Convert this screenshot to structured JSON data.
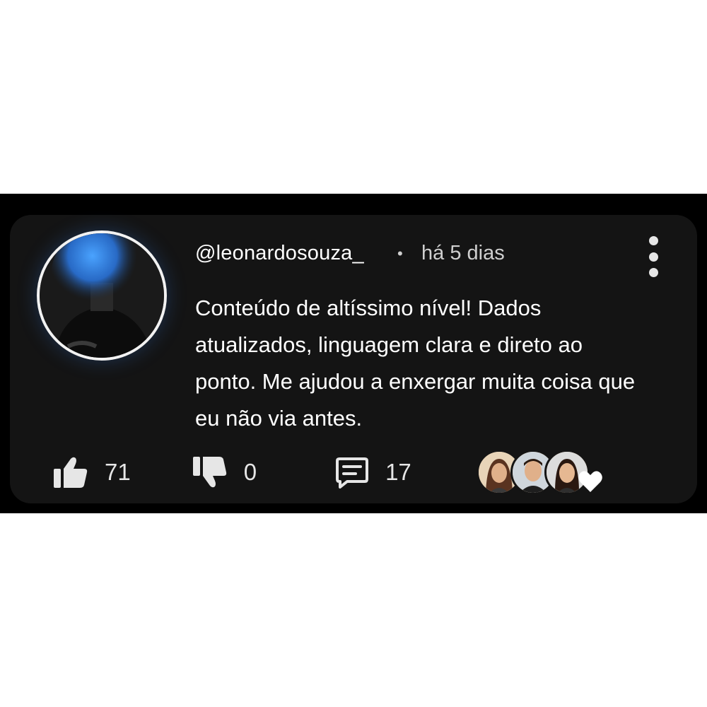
{
  "comment": {
    "author": "@leonardosouza_",
    "separator": "•",
    "time": "há 5 dias",
    "body": "Conteúdo de altíssimo nível! Dados atualizados, linguagem clara e direto ao ponto. Me ajudou a enxergar muita coisa que eu não via antes.",
    "likes": "71",
    "dislikes": "0",
    "replies": "17"
  },
  "icons": {
    "like": "thumbs-up-icon",
    "dislike": "thumbs-down-icon",
    "reply": "comment-icon",
    "menu": "more-vertical-icon",
    "heart": "heart-icon"
  },
  "colors": {
    "band": "#000000",
    "card": "#141414",
    "text": "#ffffff",
    "muted": "#cfcfcf",
    "avatar_glow": "#3c8cff"
  }
}
